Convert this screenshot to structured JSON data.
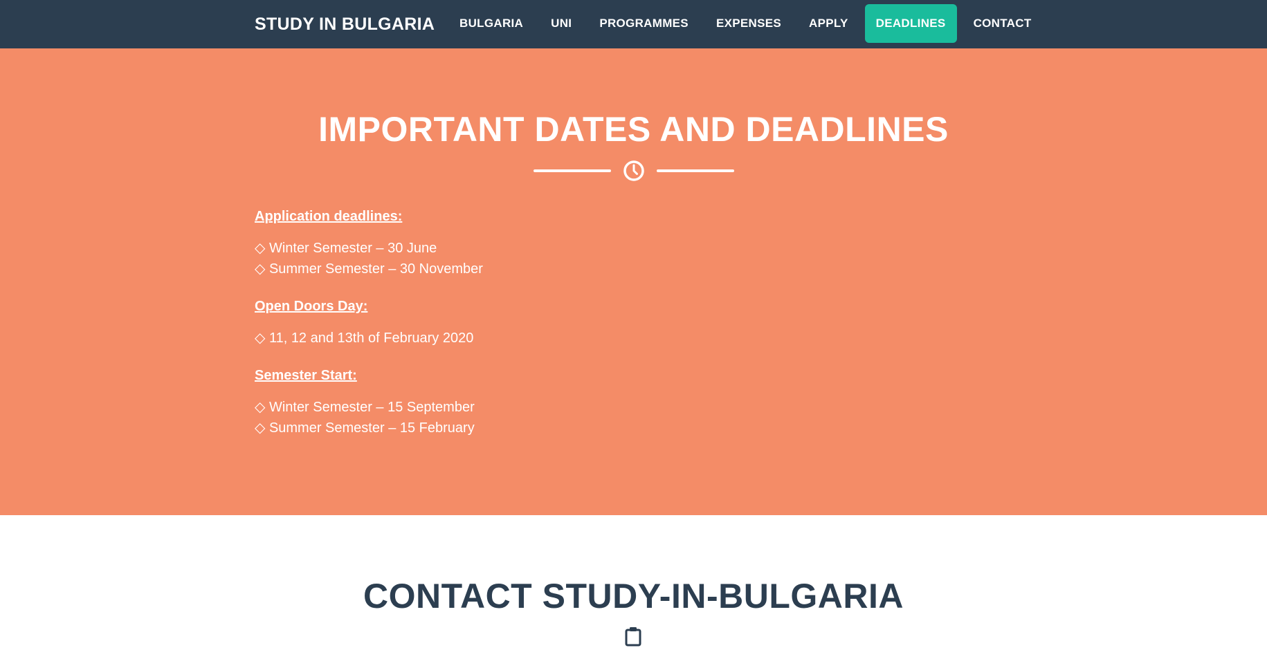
{
  "navbar": {
    "brand": "STUDY IN BULGARIA",
    "links": [
      {
        "label": "BULGARIA"
      },
      {
        "label": "UNI"
      },
      {
        "label": "PROGRAMMES"
      },
      {
        "label": "EXPENSES"
      },
      {
        "label": "APPLY"
      },
      {
        "label": "DEADLINES",
        "active": true
      },
      {
        "label": "CONTACT"
      }
    ]
  },
  "deadlines": {
    "title": "IMPORTANT DATES AND DEADLINES",
    "divider_icon": "clock-icon",
    "groups": [
      {
        "heading": "Application deadlines:",
        "items": [
          "◇ Winter Semester – 30 June",
          "◇ Summer Semester – 30 November"
        ]
      },
      {
        "heading": "Open Doors Day:",
        "items": [
          "◇ 11, 12 and 13th of February 2020"
        ]
      },
      {
        "heading": "Semester Start:",
        "items": [
          "◇ Winter Semester – 15 September",
          "◇ Summer Semester – 15 February"
        ]
      }
    ]
  },
  "contact": {
    "title": "CONTACT STUDY-IN-BULGARIA",
    "icon": "clipboard-icon"
  },
  "colors": {
    "navbar_bg": "#2c3e50",
    "accent": "#1abc9c",
    "section_bg": "#f48c67",
    "text_dark": "#2c3e50"
  }
}
